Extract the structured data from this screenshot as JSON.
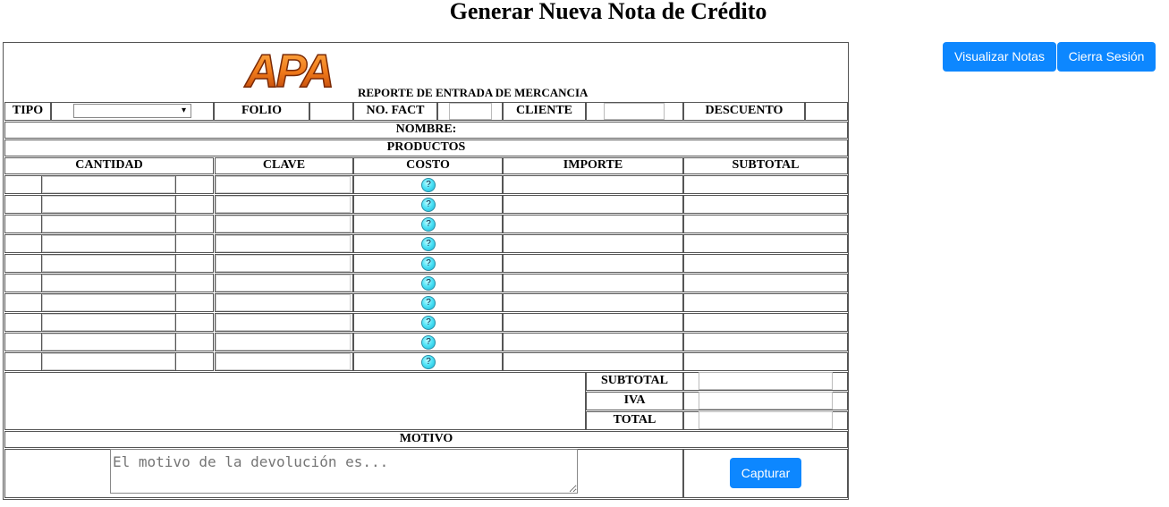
{
  "page": {
    "title": "Generar Nueva Nota de Crédito"
  },
  "nav": {
    "visualizar_label": "Visualizar Notas",
    "logout_label": "Cierra Sesión"
  },
  "header": {
    "logo_text": "APA",
    "report_title": "REPORTE DE ENTRADA DE MERCANCIA",
    "tipo_label": "TIPO",
    "tipo_value": "",
    "folio_label": "FOLIO",
    "nofact_label": "NO. FACT",
    "cliente_label": "CLIENTE",
    "descuento_label": "DESCUENTO",
    "nombre_label": "NOMBRE:"
  },
  "products": {
    "section_label": "PRODUCTOS",
    "columns": [
      "CANTIDAD",
      "CLAVE",
      "COSTO",
      "IMPORTE",
      "SUBTOTAL"
    ],
    "row_count": 10,
    "help_symbol": "?"
  },
  "totals": {
    "subtotal_label": "SUBTOTAL",
    "iva_label": "IVA",
    "total_label": "TOTAL"
  },
  "motivo": {
    "label": "MOTIVO",
    "placeholder": "El motivo de la devolución es..."
  },
  "actions": {
    "capturar_label": "Capturar"
  },
  "colors": {
    "accent": "#0d87ff",
    "help_icon": "#4fe3f7",
    "border": "#555555"
  }
}
